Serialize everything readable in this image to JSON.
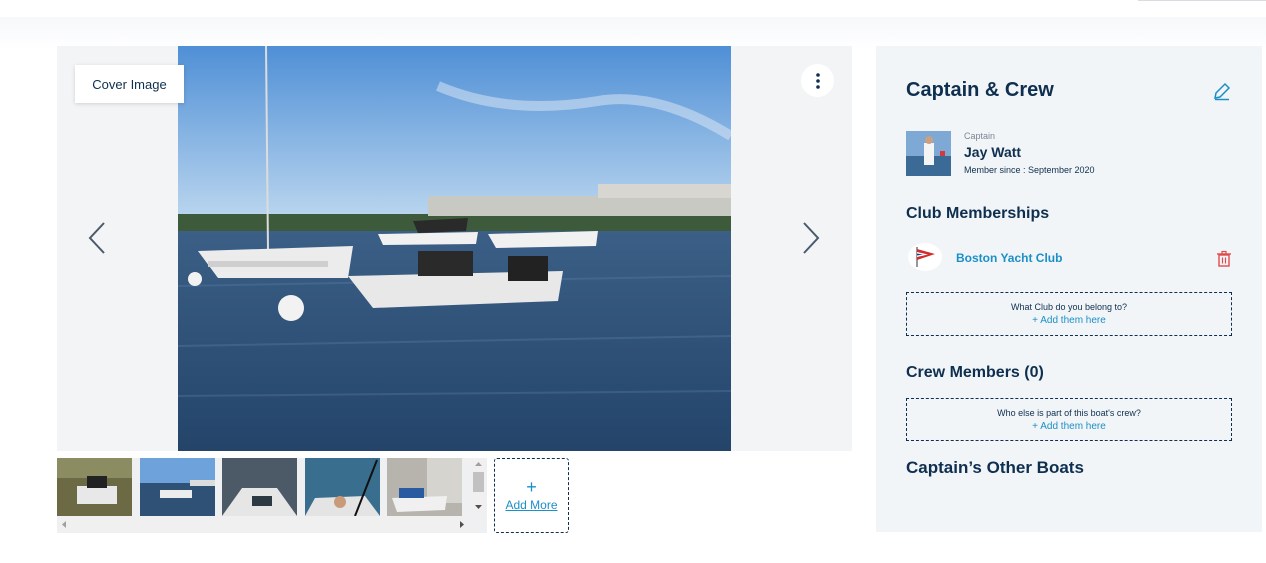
{
  "gallery": {
    "cover_label": "Cover Image",
    "menu_icon": "kebab-menu-icon",
    "prev_icon": "chevron-left-icon",
    "next_icon": "chevron-right-icon",
    "thumbnails_count": 5,
    "add_more": {
      "plus": "+",
      "label": "Add More"
    }
  },
  "panel": {
    "title": "Captain & Crew",
    "edit_icon": "pencil-icon",
    "captain": {
      "role": "Captain",
      "name": "Jay Watt",
      "member_since": "Member since : September 2020"
    },
    "club_section": {
      "title": "Club Memberships",
      "clubs": [
        {
          "name": "Boston Yacht Club"
        }
      ],
      "delete_icon": "trash-icon",
      "prompt": "What Club do you belong to?",
      "action": "+ Add them here"
    },
    "crew_section": {
      "title": "Crew Members (0)",
      "prompt": "Who else is part of this boat's crew?",
      "action": "+ Add them here"
    },
    "other_boats_title": "Captain’s Other Boats"
  },
  "colors": {
    "navy": "#0e2f4f",
    "accent_blue": "#1b8fc7",
    "delete_red": "#e04a4a",
    "panel_bg": "#f2f5f7"
  }
}
